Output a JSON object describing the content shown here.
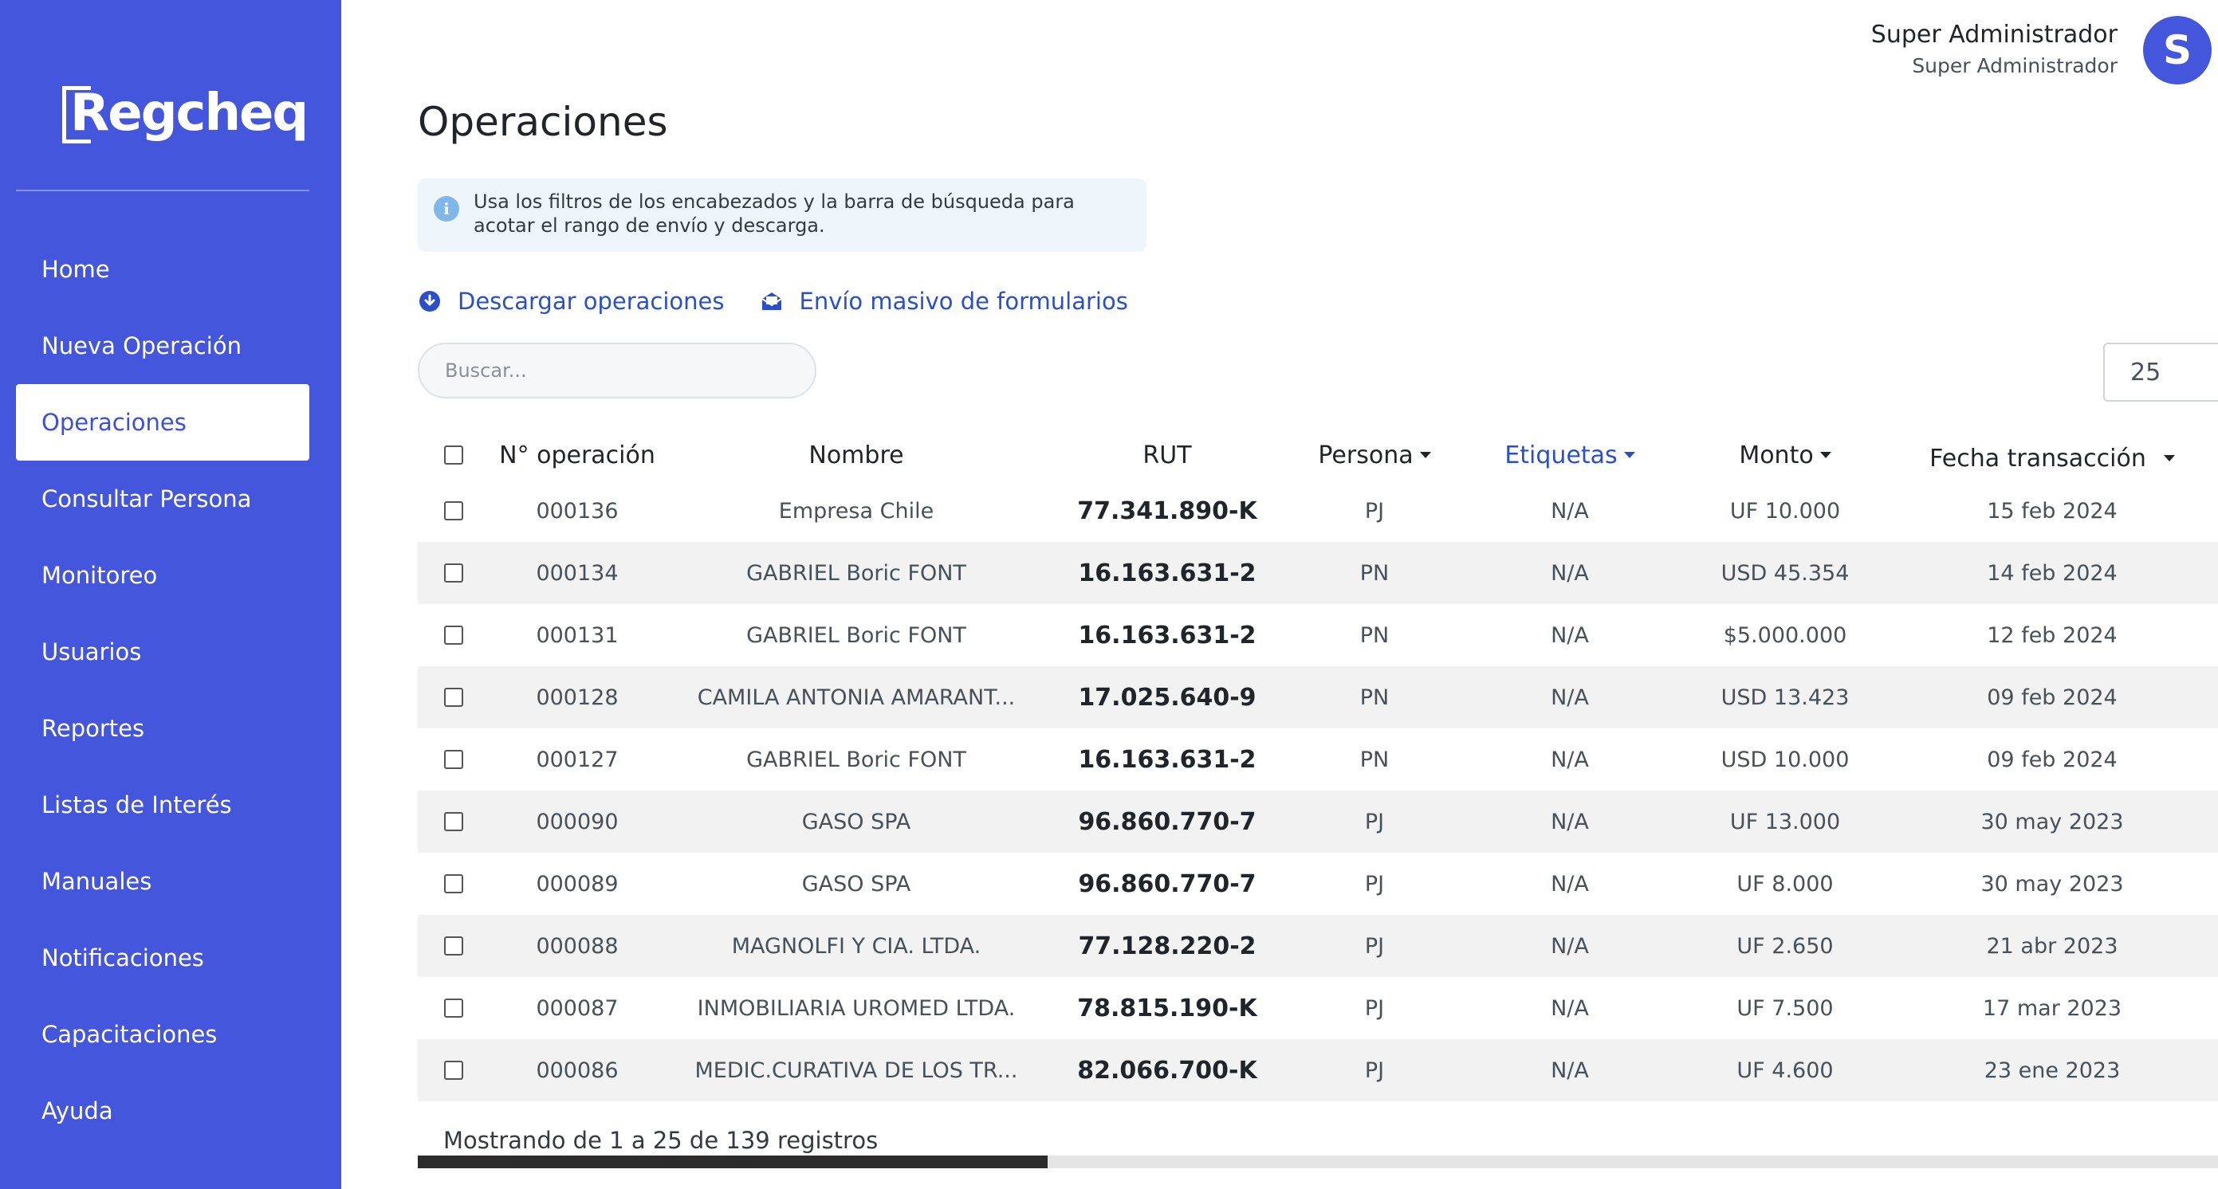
{
  "app": {
    "logo_text": "Regcheq"
  },
  "sidebar": {
    "items": [
      {
        "label": "Home",
        "active": false
      },
      {
        "label": "Nueva Operación",
        "active": false
      },
      {
        "label": "Operaciones",
        "active": true
      },
      {
        "label": "Consultar Persona",
        "active": false
      },
      {
        "label": "Monitoreo",
        "active": false
      },
      {
        "label": "Usuarios",
        "active": false
      },
      {
        "label": "Reportes",
        "active": false
      },
      {
        "label": "Listas de Interés",
        "active": false
      },
      {
        "label": "Manuales",
        "active": false
      },
      {
        "label": "Notificaciones",
        "active": false
      },
      {
        "label": "Capacitaciones",
        "active": false
      },
      {
        "label": "Ayuda",
        "active": false
      }
    ]
  },
  "user": {
    "name": "Super Administrador",
    "role": "Super Administrador",
    "initial": "S"
  },
  "page": {
    "title": "Operaciones",
    "info": "Usa los filtros de los encabezados y la barra de búsqueda para acotar el rango de envío y descarga.",
    "info_icon": "i",
    "actions": {
      "download": "Descargar operaciones",
      "bulk_send": "Envío masivo de formularios"
    },
    "search_placeholder": "Buscar...",
    "page_size": "25"
  },
  "table": {
    "headers": {
      "op": "N° operación",
      "nombre": "Nombre",
      "rut": "RUT",
      "persona": "Persona",
      "etiquetas": "Etiquetas",
      "monto": "Monto",
      "fecha": "Fecha transacción"
    },
    "rows": [
      {
        "op": "000136",
        "nombre": "Empresa Chile",
        "rut": "77.341.890-K",
        "persona": "PJ",
        "etiquetas": "N/A",
        "monto": "UF 10.000",
        "fecha": "15 feb 2024"
      },
      {
        "op": "000134",
        "nombre": "GABRIEL Boric FONT",
        "rut": "16.163.631-2",
        "persona": "PN",
        "etiquetas": "N/A",
        "monto": "USD 45.354",
        "fecha": "14 feb 2024"
      },
      {
        "op": "000131",
        "nombre": "GABRIEL Boric FONT",
        "rut": "16.163.631-2",
        "persona": "PN",
        "etiquetas": "N/A",
        "monto": "$5.000.000",
        "fecha": "12 feb 2024"
      },
      {
        "op": "000128",
        "nombre": "CAMILA ANTONIA AMARANT...",
        "rut": "17.025.640-9",
        "persona": "PN",
        "etiquetas": "N/A",
        "monto": "USD 13.423",
        "fecha": "09 feb 2024"
      },
      {
        "op": "000127",
        "nombre": "GABRIEL Boric FONT",
        "rut": "16.163.631-2",
        "persona": "PN",
        "etiquetas": "N/A",
        "monto": "USD 10.000",
        "fecha": "09 feb 2024"
      },
      {
        "op": "000090",
        "nombre": "GASO SPA",
        "rut": "96.860.770-7",
        "persona": "PJ",
        "etiquetas": "N/A",
        "monto": "UF 13.000",
        "fecha": "30 may 2023"
      },
      {
        "op": "000089",
        "nombre": "GASO SPA",
        "rut": "96.860.770-7",
        "persona": "PJ",
        "etiquetas": "N/A",
        "monto": "UF 8.000",
        "fecha": "30 may 2023"
      },
      {
        "op": "000088",
        "nombre": "MAGNOLFI Y CIA. LTDA.",
        "rut": "77.128.220-2",
        "persona": "PJ",
        "etiquetas": "N/A",
        "monto": "UF 2.650",
        "fecha": "21 abr 2023"
      },
      {
        "op": "000087",
        "nombre": "INMOBILIARIA UROMED LTDA.",
        "rut": "78.815.190-K",
        "persona": "PJ",
        "etiquetas": "N/A",
        "monto": "UF 7.500",
        "fecha": "17 mar 2023"
      },
      {
        "op": "000086",
        "nombre": "MEDIC.CURATIVA DE LOS TR...",
        "rut": "82.066.700-K",
        "persona": "PJ",
        "etiquetas": "N/A",
        "monto": "UF 4.600",
        "fecha": "23 ene 2023"
      }
    ],
    "footer": "Mostrando de 1 a 25 de 139 registros"
  },
  "colors": {
    "sidebar": "#4456dc",
    "accent": "#2950c8",
    "stripe": "#f2f2f2"
  },
  "icons": {
    "info": "info-icon",
    "download": "download-circle-icon",
    "bulk_send": "mail-open-icon"
  }
}
